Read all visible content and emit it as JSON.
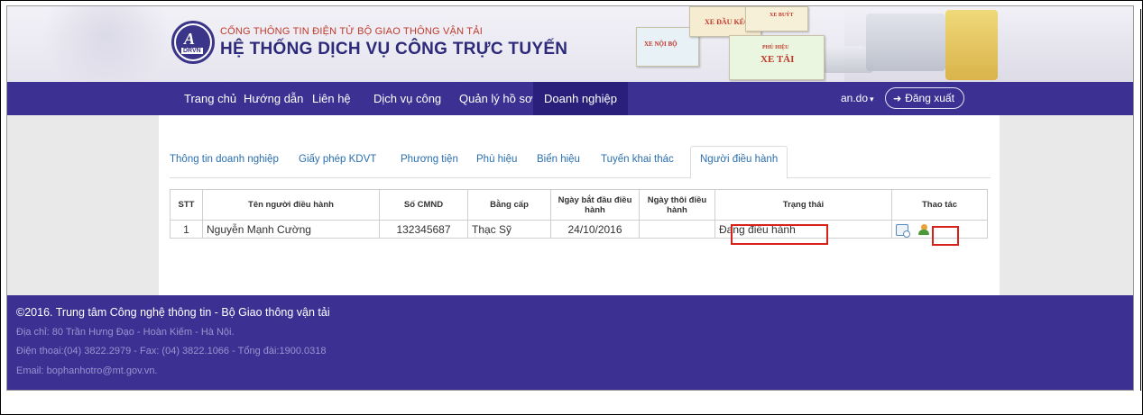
{
  "header": {
    "logo_text": "DRVN",
    "subtitle": "CỔNG THÔNG TIN ĐIỆN TỬ BỘ GIAO THÔNG VẬN TẢI",
    "title": "HỆ THỐNG DỊCH VỤ CÔNG TRỰC TUYẾN",
    "cards": [
      "XE NỘI BỘ",
      "XE ĐẦU KÉO",
      "XE BUÝT",
      "PHÙ HIỆU",
      "XE TẢI"
    ]
  },
  "nav": {
    "items": [
      "Trang chủ",
      "Hướng dẫn",
      "Liên hệ",
      "Dịch vụ công",
      "Quản lý hồ sơ",
      "Doanh nghiệp"
    ],
    "active_index": 5,
    "user": "an.do",
    "user_caret": "▾",
    "logout_icon": "sign-out-icon",
    "logout_label": "Đăng xuất"
  },
  "tabs": {
    "items": [
      "Thông tin doanh nghiệp",
      "Giấy phép KDVT",
      "Phương tiện",
      "Phù hiệu",
      "Biển hiệu",
      "Tuyến khai thác",
      "Người điều hành"
    ],
    "active_index": 6
  },
  "table": {
    "headers": [
      "STT",
      "Tên người điều hành",
      "Số CMND",
      "Bằng cấp",
      "Ngày bắt đầu điều hành",
      "Ngày thôi điều hành",
      "Trạng thái",
      "Thao tác"
    ],
    "rows": [
      {
        "stt": "1",
        "name": "Nguyễn Mạnh Cường",
        "cmnd": "132345687",
        "degree": "Thạc Sỹ",
        "start": "24/10/2016",
        "end": "",
        "status": "Đang điều hành",
        "actions": [
          "view-detail-icon",
          "user-edit-icon"
        ]
      }
    ]
  },
  "footer": {
    "title": "©2016. Trung tâm Công nghệ thông tin - Bộ Giao thông vận tải",
    "address": "Địa chỉ: 80 Trần Hưng Đạo - Hoàn Kiếm - Hà Nội.",
    "phone": "Điện thoại:(04) 3822.2979 - Fax: (04) 3822.1066 - Tổng đài:1900.0318",
    "email": "Email: bophanhotro@mt.gov.vn."
  },
  "colors": {
    "nav_bg": "#3c3093",
    "nav_active": "#2a1f7a",
    "highlight_red": "#d9201b",
    "link_blue": "#2a6fb0"
  }
}
